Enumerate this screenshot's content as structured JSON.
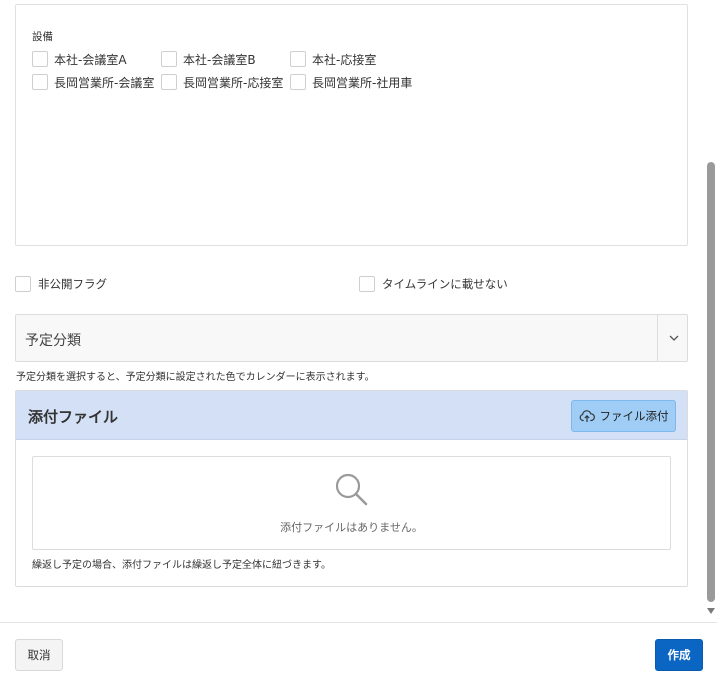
{
  "equipment": {
    "label": "設備",
    "options": [
      {
        "label": "本社-会議室A",
        "checked": false
      },
      {
        "label": "本社-会議室B",
        "checked": false
      },
      {
        "label": "本社-応接室",
        "checked": false
      },
      {
        "label": "長岡営業所-会議室",
        "checked": false
      },
      {
        "label": "長岡営業所-応接室",
        "checked": false
      },
      {
        "label": "長岡営業所-社用車",
        "checked": false
      }
    ]
  },
  "flags": {
    "private_label": "非公開フラグ",
    "timeline_label": "タイムラインに載せない"
  },
  "category": {
    "value": "予定分類",
    "hint": "予定分類を選択すると、予定分類に設定された色でカレンダーに表示されます。"
  },
  "attachments": {
    "title": "添付ファイル",
    "add_button_label": "ファイル添付",
    "add_button_icon": "cloud-upload-icon",
    "empty_icon": "search-icon",
    "empty_text": "添付ファイルはありません。",
    "note": "繰返し予定の場合、添付ファイルは繰返し予定全体に紐づきます。"
  },
  "footer": {
    "cancel_label": "取消",
    "create_label": "作成"
  },
  "colors": {
    "attach_header_bg": "#d3e0f5",
    "attach_button_bg": "#9fcdf5",
    "primary_button_bg": "#0b66c3"
  }
}
